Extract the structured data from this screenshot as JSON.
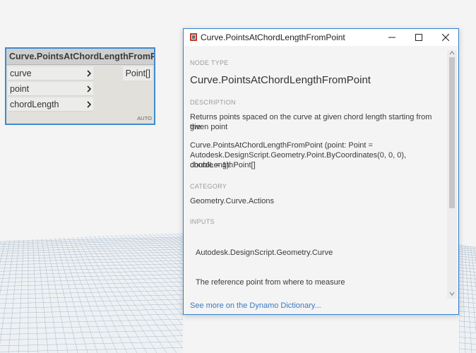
{
  "node": {
    "title": "Curve.PointsAtChordLengthFromPoint",
    "inputs": [
      "curve",
      "point",
      "chordLength"
    ],
    "output": "Point[]",
    "lacing": "AUTO"
  },
  "tooltip": {
    "window_title": "Curve.PointsAtChordLengthFromPoint",
    "node_type_heading": "NODE TYPE",
    "node_type": "Curve.PointsAtChordLengthFromPoint",
    "description_heading": "DESCRIPTION",
    "description_line1": "Returns points spaced on the curve at given chord length starting from the",
    "description_line2": "given point",
    "signature_line1": "Curve.PointsAtChordLengthFromPoint (point: Point =",
    "signature_line2": "Autodesk.DesignScript.Geometry.Point.ByCoordinates(0, 0, 0), chordLength:",
    "signature_line3": "double = 1): Point[]",
    "category_heading": "CATEGORY",
    "category": "Geometry.Curve.Actions",
    "inputs_heading": "INPUTS",
    "input1_type": "Autodesk.DesignScript.Geometry.Curve",
    "input2_desc": "The reference point from where to measure",
    "see_more": "See more on the Dynamo Dictionary..."
  },
  "colors": {
    "accent": "#2f7fd0",
    "link": "#3c78c0"
  }
}
